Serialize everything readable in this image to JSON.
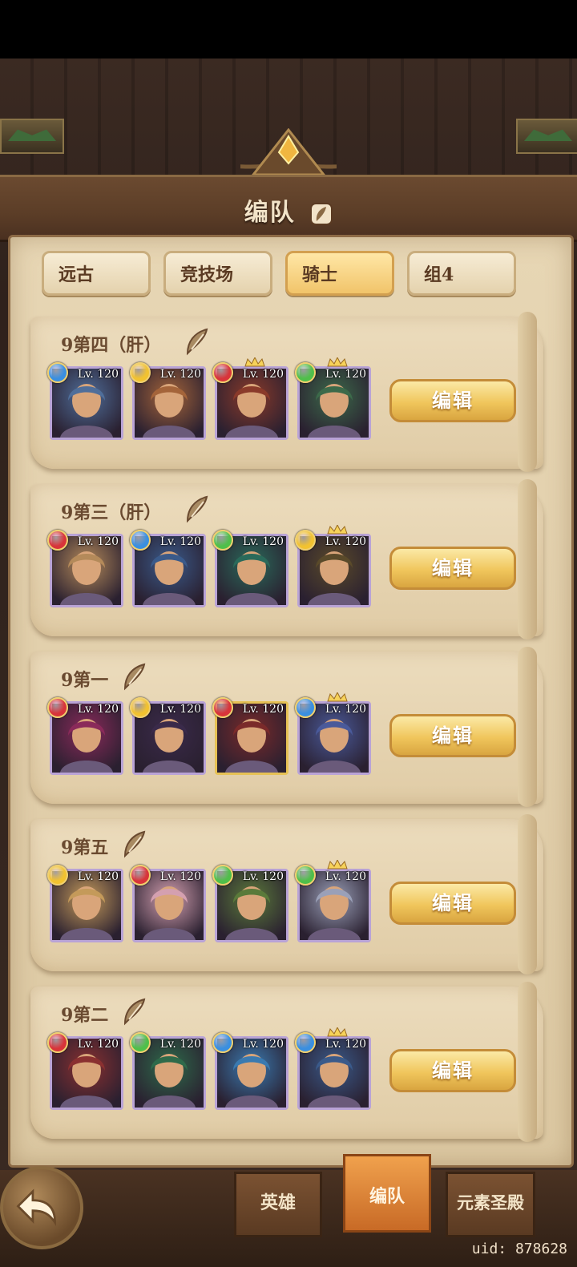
{
  "header": {
    "title": "编队"
  },
  "tabs": [
    {
      "label": "远古",
      "active": false
    },
    {
      "label": "竞技场",
      "active": false
    },
    {
      "label": "骑士",
      "active": true
    },
    {
      "label": "组4",
      "active": false
    }
  ],
  "teams": [
    {
      "name": "9第四（肝）",
      "edit_label": "编辑",
      "heroes": [
        {
          "level": "Lv. 120",
          "element": "water"
        },
        {
          "level": "Lv. 120",
          "element": "light"
        },
        {
          "level": "Lv. 120",
          "element": "fire"
        },
        {
          "level": "Lv. 120",
          "element": "nature"
        }
      ]
    },
    {
      "name": "9第三（肝）",
      "edit_label": "编辑",
      "heroes": [
        {
          "level": "Lv. 120",
          "element": "fire"
        },
        {
          "level": "Lv. 120",
          "element": "water"
        },
        {
          "level": "Lv. 120",
          "element": "nature"
        },
        {
          "level": "Lv. 120",
          "element": "light"
        }
      ]
    },
    {
      "name": "9第一",
      "edit_label": "编辑",
      "heroes": [
        {
          "level": "Lv. 120",
          "element": "fire"
        },
        {
          "level": "Lv. 120",
          "element": "light"
        },
        {
          "level": "Lv. 120",
          "element": "fire"
        },
        {
          "level": "Lv. 120",
          "element": "water"
        }
      ]
    },
    {
      "name": "9第五",
      "edit_label": "编辑",
      "heroes": [
        {
          "level": "Lv. 120",
          "element": "light"
        },
        {
          "level": "Lv. 120",
          "element": "fire"
        },
        {
          "level": "Lv. 120",
          "element": "nature"
        },
        {
          "level": "Lv. 120",
          "element": "nature"
        }
      ]
    },
    {
      "name": "9第二",
      "edit_label": "编辑",
      "heroes": [
        {
          "level": "Lv. 120",
          "element": "fire"
        },
        {
          "level": "Lv. 120",
          "element": "nature"
        },
        {
          "level": "Lv. 120",
          "element": "water"
        },
        {
          "level": "Lv. 120",
          "element": "water"
        }
      ]
    }
  ],
  "bottom_nav": [
    {
      "label": "英雄",
      "active": false
    },
    {
      "label": "编队",
      "active": true
    },
    {
      "label": "元素圣殿",
      "active": false
    }
  ],
  "uid": "uid: 878628",
  "colors": {
    "fire": "#d8343a",
    "water": "#3a8fe0",
    "light": "#f2c230",
    "nature": "#4fbf4a"
  }
}
